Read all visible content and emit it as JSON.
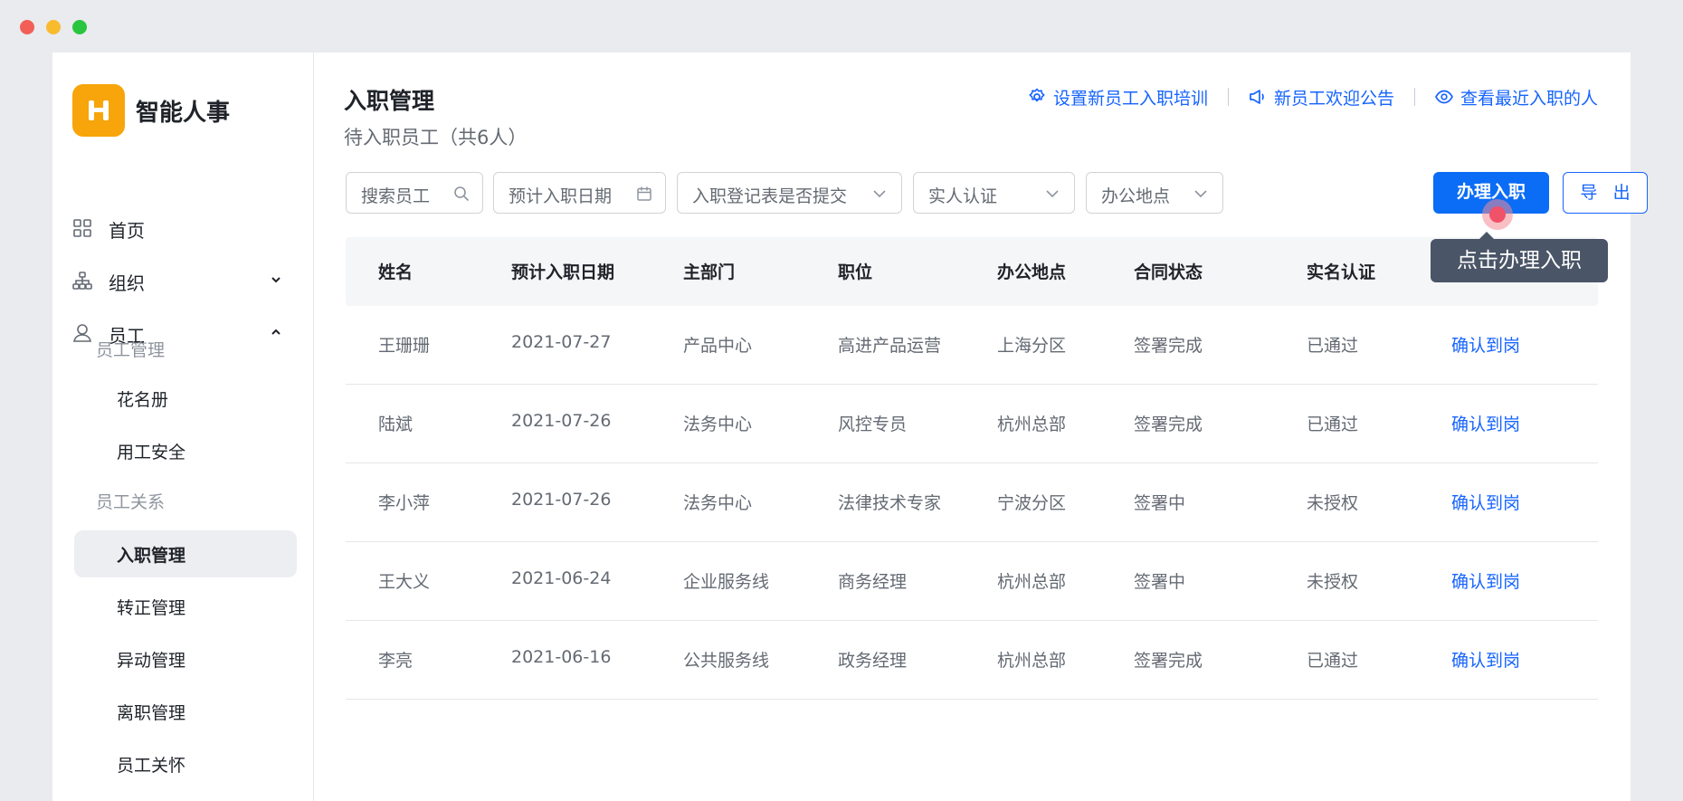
{
  "app": {
    "brand": "智能人事",
    "logo_glyph": "H",
    "brand_color": "#f7a50a",
    "accent": "#1664ff"
  },
  "sidebar": {
    "nav": [
      {
        "label": "首页",
        "icon": "grid-icon"
      },
      {
        "label": "组织",
        "icon": "org-chart-icon",
        "chevron": "down"
      },
      {
        "label": "员工",
        "icon": "user-icon",
        "chevron": "up"
      }
    ],
    "groups": [
      {
        "heading": "员工管理",
        "items": [
          "花名册",
          "用工安全"
        ]
      },
      {
        "heading": "员工关系",
        "items": [
          "入职管理",
          "转正管理",
          "异动管理",
          "离职管理",
          "员工关怀"
        ]
      }
    ],
    "active_item": "入职管理"
  },
  "header": {
    "title": "入职管理",
    "subtitle": "待入职员工（共6人）",
    "links": [
      {
        "label": "设置新员工入职培训",
        "icon": "gear-icon"
      },
      {
        "label": "新员工欢迎公告",
        "icon": "megaphone-icon"
      },
      {
        "label": "查看最近入职的人",
        "icon": "eye-icon"
      }
    ]
  },
  "filters": {
    "search_placeholder": "搜索员工",
    "date_placeholder": "预计入职日期",
    "form_submitted": "入职登记表是否提交",
    "real_auth": "实人认证",
    "office": "办公地点"
  },
  "actions": {
    "primary": "办理入职",
    "export": "导 出"
  },
  "tooltip": "点击办理入职",
  "table": {
    "columns": [
      "姓名",
      "预计入职日期",
      "主部门",
      "职位",
      "办公地点",
      "合同状态",
      "实名认证"
    ],
    "rows": [
      {
        "name": "王珊珊",
        "date": "2021-07-27",
        "dept": "产品中心",
        "position": "高进产品运营",
        "office": "上海分区",
        "contract": "签署完成",
        "auth": "已通过",
        "action": "确认到岗"
      },
      {
        "name": "陆斌",
        "date": "2021-07-26",
        "dept": "法务中心",
        "position": "风控专员",
        "office": "杭州总部",
        "contract": "签署完成",
        "auth": "已通过",
        "action": "确认到岗"
      },
      {
        "name": "李小萍",
        "date": "2021-07-26",
        "dept": "法务中心",
        "position": "法律技术专家",
        "office": "宁波分区",
        "contract": "签署中",
        "auth": "未授权",
        "action": "确认到岗"
      },
      {
        "name": "王大义",
        "date": "2021-06-24",
        "dept": "企业服务线",
        "position": "商务经理",
        "office": "杭州总部",
        "contract": "签署中",
        "auth": "未授权",
        "action": "确认到岗"
      },
      {
        "name": "李亮",
        "date": "2021-06-16",
        "dept": "公共服务线",
        "position": "政务经理",
        "office": "杭州总部",
        "contract": "签署完成",
        "auth": "已通过",
        "action": "确认到岗"
      }
    ]
  }
}
